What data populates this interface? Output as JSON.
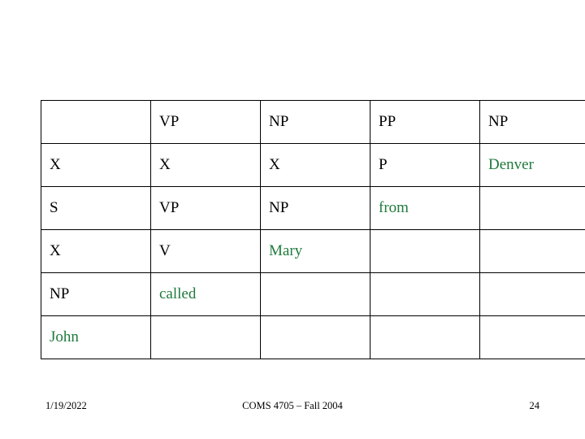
{
  "slide": {
    "table": {
      "rows": [
        [
          {
            "text": "",
            "color": "none"
          },
          {
            "text": "VP",
            "color": "black"
          },
          {
            "text": "NP",
            "color": "black"
          },
          {
            "text": "PP",
            "color": "black"
          },
          {
            "text": "NP",
            "color": "black"
          }
        ],
        [
          {
            "text": "X",
            "color": "black"
          },
          {
            "text": "X",
            "color": "black"
          },
          {
            "text": "X",
            "color": "black"
          },
          {
            "text": "P",
            "color": "black"
          },
          {
            "text": "Denver",
            "color": "green"
          }
        ],
        [
          {
            "text": "S",
            "color": "black"
          },
          {
            "text": "VP",
            "color": "black"
          },
          {
            "text": "NP",
            "color": "black"
          },
          {
            "text": "from",
            "color": "green"
          },
          {
            "text": "",
            "color": "none"
          }
        ],
        [
          {
            "text": "X",
            "color": "black"
          },
          {
            "text": "V",
            "color": "black"
          },
          {
            "text": "Mary",
            "color": "green"
          },
          {
            "text": "",
            "color": "none"
          },
          {
            "text": "",
            "color": "none"
          }
        ],
        [
          {
            "text": "NP",
            "color": "black"
          },
          {
            "text": "called",
            "color": "green"
          },
          {
            "text": "",
            "color": "none"
          },
          {
            "text": "",
            "color": "none"
          },
          {
            "text": "",
            "color": "none"
          }
        ],
        [
          {
            "text": "John",
            "color": "green"
          },
          {
            "text": "",
            "color": "none"
          },
          {
            "text": "",
            "color": "none"
          },
          {
            "text": "",
            "color": "none"
          },
          {
            "text": "",
            "color": "none"
          }
        ]
      ]
    },
    "footer": {
      "date": "1/19/2022",
      "center": "COMS 4705 – Fall 2004",
      "page": "24"
    },
    "colors": {
      "terminal_green": "#1f7a3d",
      "nonterminal_black": "#000000",
      "border": "#000000"
    }
  }
}
